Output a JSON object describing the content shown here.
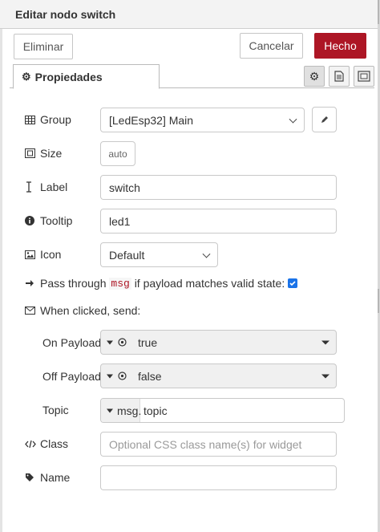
{
  "header": {
    "title": "Editar nodo switch"
  },
  "buttons": {
    "delete": "Eliminar",
    "cancel": "Cancelar",
    "done": "Hecho"
  },
  "tabs": [
    {
      "label": "Propiedades"
    }
  ],
  "tab_icons": [
    "gear-icon",
    "document-icon",
    "frame-icon"
  ],
  "form": {
    "group": {
      "label": "Group",
      "value": "[LedEsp32] Main"
    },
    "size": {
      "label": "Size",
      "value": "auto"
    },
    "label": {
      "label": "Label",
      "value": "switch"
    },
    "tooltip": {
      "label": "Tooltip",
      "value": "led1"
    },
    "icon": {
      "label": "Icon",
      "value": "Default"
    },
    "passthru": {
      "text_before": "Pass through",
      "code": "msg",
      "text_after": "if payload matches valid state:",
      "checked": true
    },
    "when_clicked": {
      "label": "When clicked, send:"
    },
    "on_payload": {
      "label": "On Payload",
      "value": "true"
    },
    "off_payload": {
      "label": "Off Payload",
      "value": "false"
    },
    "topic": {
      "label": "Topic",
      "prefix": "msg.",
      "value": "topic"
    },
    "class": {
      "label": "Class",
      "placeholder": "Optional CSS class name(s) for widget"
    },
    "name": {
      "label": "Name",
      "value": ""
    }
  },
  "colors": {
    "primary": "#ad1625",
    "code": "#ad1625",
    "checkbox": "#1a73e8"
  }
}
